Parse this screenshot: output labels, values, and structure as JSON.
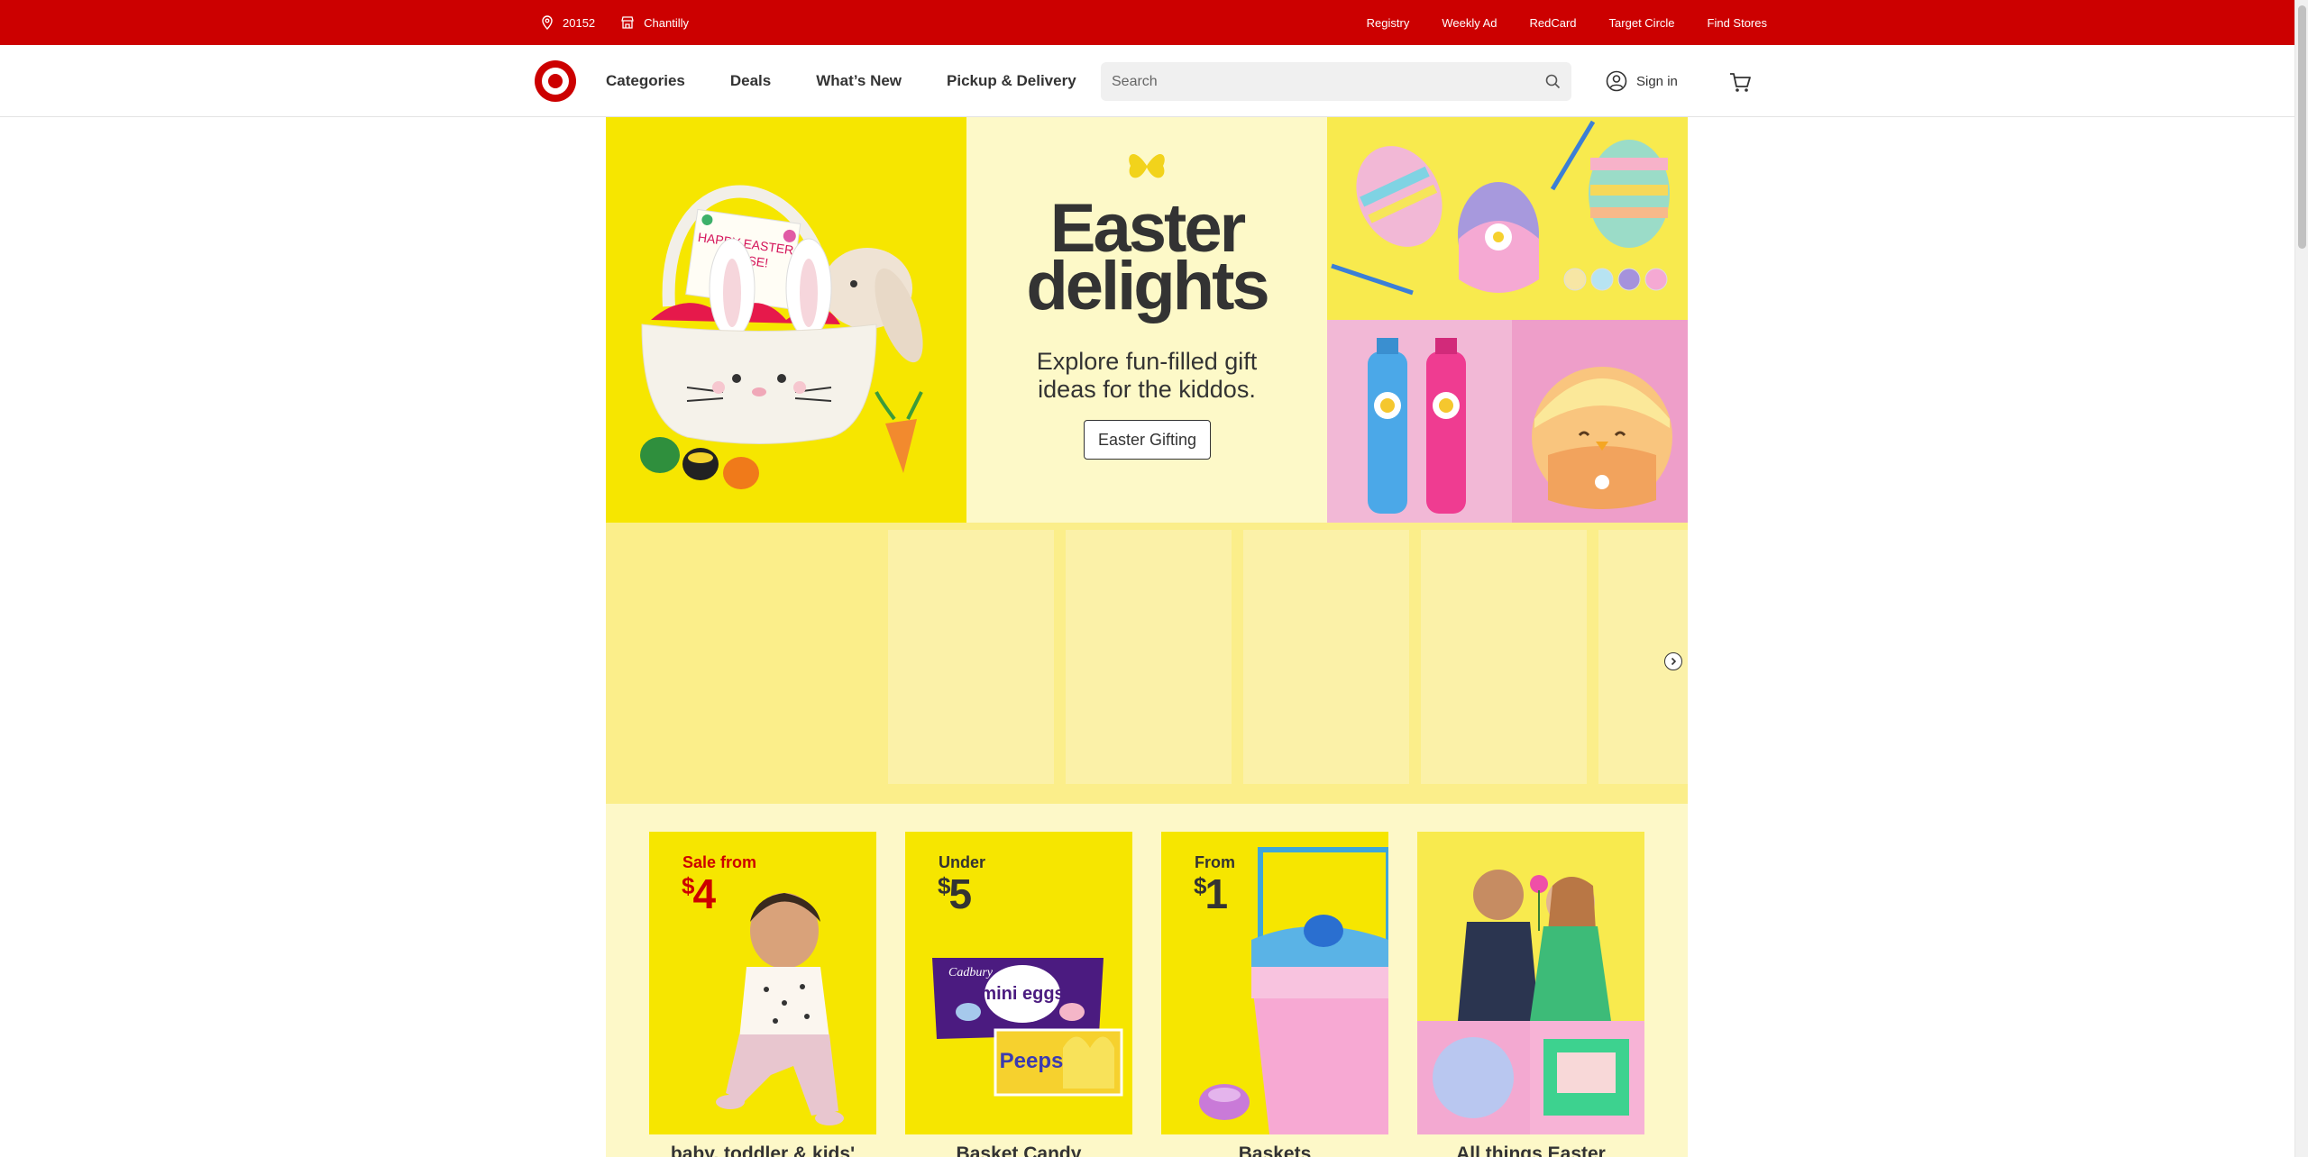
{
  "utility": {
    "zip": "20152",
    "store": "Chantilly",
    "links": [
      "Registry",
      "Weekly Ad",
      "RedCard",
      "Target Circle",
      "Find Stores"
    ]
  },
  "header": {
    "nav": [
      "Categories",
      "Deals",
      "What’s New",
      "Pickup & Delivery"
    ],
    "search_placeholder": "Search",
    "signin": "Sign in"
  },
  "hero": {
    "title_line1": "Easter",
    "title_line2": "delights",
    "subtitle": "Explore fun-filled gift ideas for the kiddos.",
    "button": "Easter Gifting",
    "basket_card_text": "HAPPY EASTER MOUSE!"
  },
  "deals": [
    {
      "pre": "Sale from",
      "price": "4",
      "title": "baby, toddler & kids'",
      "pre_color": "#cc0000"
    },
    {
      "pre": "Under",
      "price": "5",
      "title": "Basket Candy",
      "pre_color": "#333333",
      "candy1": "mini eggs",
      "candy2": "Peeps",
      "brand": "Cadbury"
    },
    {
      "pre": "From",
      "price": "1",
      "title": "Baskets",
      "pre_color": "#333333"
    },
    {
      "pre": "",
      "price": "",
      "title": "All things Easter",
      "pre_color": "#333333"
    }
  ],
  "colors": {
    "brand_red": "#cc0000",
    "hero_yellow": "#f6e600",
    "hero_cream": "#fdf9c8",
    "carousel_bg": "#fbee8a"
  }
}
